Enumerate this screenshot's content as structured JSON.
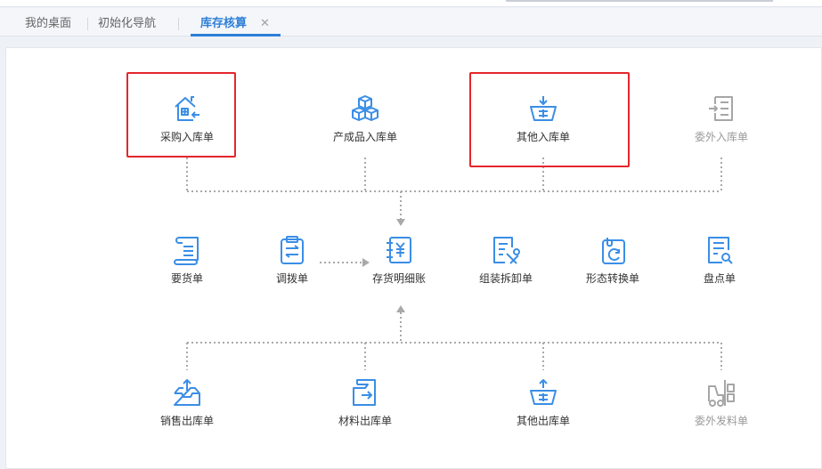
{
  "tabs": [
    {
      "label": "我的桌面"
    },
    {
      "label": "初始化导航"
    },
    {
      "label": "库存核算"
    }
  ],
  "active_tab_close": "✕",
  "colors": {
    "accent": "#2d7fd8",
    "icon": "#3a8ee6",
    "icon_disabled": "#a6a6a6",
    "highlight": "#e4262b",
    "connector": "#a9a9a9"
  },
  "flow": {
    "inbound": [
      {
        "label": "采购入库单",
        "icon": "warehouse-in-icon"
      },
      {
        "label": "产成品入库单",
        "icon": "boxes-icon"
      },
      {
        "label": "其他入库单",
        "icon": "basket-in-icon"
      },
      {
        "label": "委外入库单",
        "icon": "outsource-in-icon"
      }
    ],
    "middle": [
      {
        "label": "要货单",
        "icon": "scroll-icon"
      },
      {
        "label": "调拨单",
        "icon": "transfer-icon"
      },
      {
        "label": "存货明细账",
        "icon": "ledger-icon"
      },
      {
        "label": "组装拆卸单",
        "icon": "assembly-icon"
      },
      {
        "label": "形态转换单",
        "icon": "conversion-icon"
      },
      {
        "label": "盘点单",
        "icon": "inventory-check-icon"
      }
    ],
    "outbound": [
      {
        "label": "销售出库单",
        "icon": "tray-out-icon"
      },
      {
        "label": "材料出库单",
        "icon": "material-out-icon"
      },
      {
        "label": "其他出库单",
        "icon": "basket-out-icon"
      },
      {
        "label": "委外发料单",
        "icon": "forklift-icon"
      }
    ]
  }
}
